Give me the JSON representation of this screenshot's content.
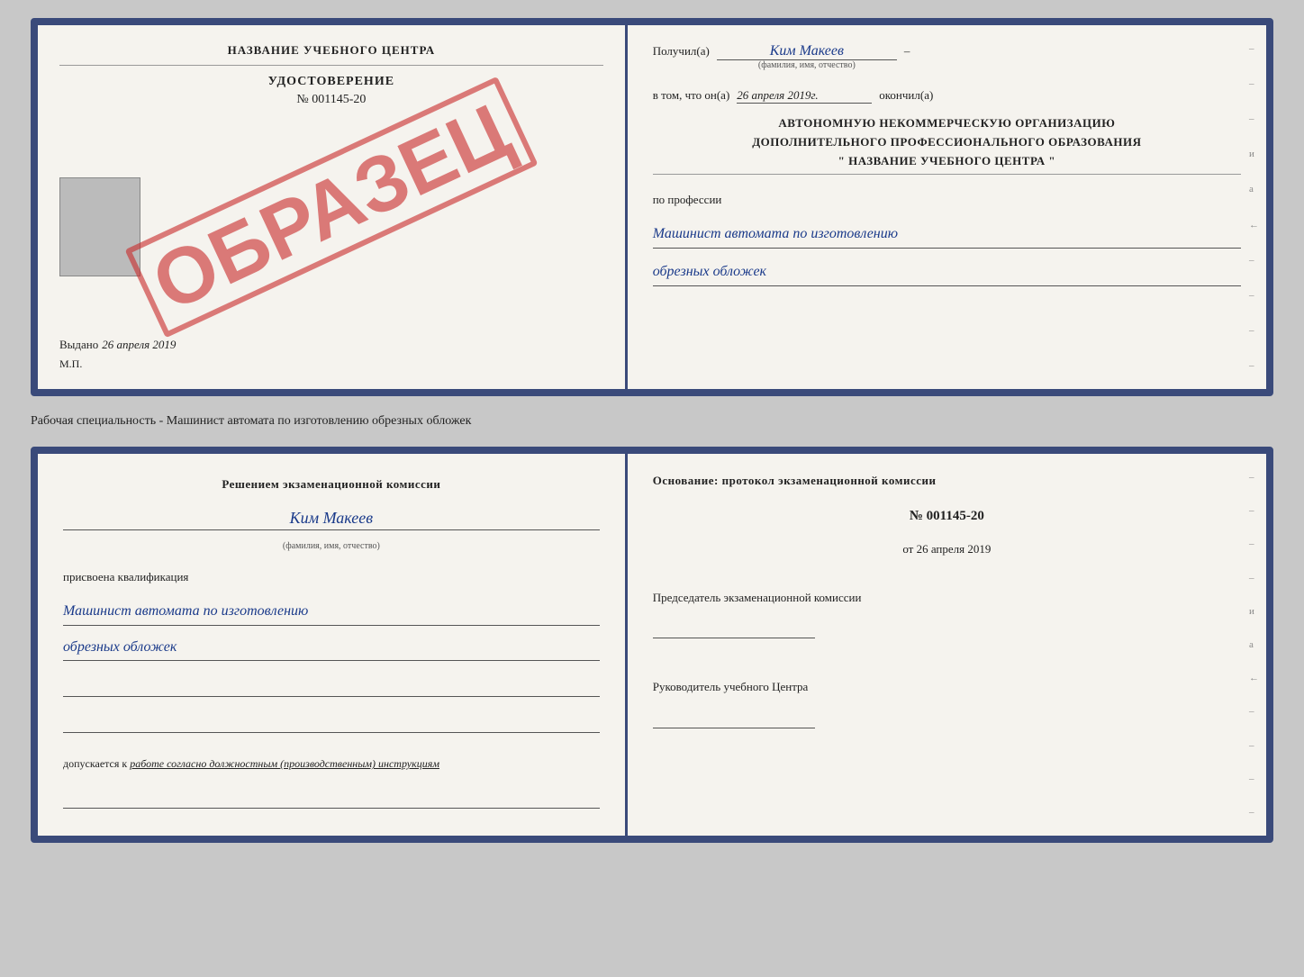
{
  "top_document": {
    "left": {
      "school_name": "НАЗВАНИЕ УЧЕБНОГО ЦЕНТРА",
      "cert_label": "УДОСТОВЕРЕНИЕ",
      "cert_number": "№ 001145-20",
      "stamp_text": "ОБРАЗЕЦ",
      "issued_prefix": "Выдано",
      "issued_date": "26 апреля 2019",
      "mp_label": "М.П."
    },
    "right": {
      "received_prefix": "Получил(а)",
      "received_name": "Ким Макеев",
      "received_subtext": "(фамилия, имя, отчество)",
      "dash": "–",
      "date_prefix": "в том, что он(а)",
      "date_value": "26 апреля 2019г.",
      "finished_suffix": "окончил(а)",
      "org_line1": "АВТОНОМНУЮ НЕКОММЕРЧЕСКУЮ ОРГАНИЗАЦИЮ",
      "org_line2": "ДОПОЛНИТЕЛЬНОГО ПРОФЕССИОНАЛЬНОГО ОБРАЗОВАНИЯ",
      "org_line3": "\"   НАЗВАНИЕ УЧЕБНОГО ЦЕНТРА   \"",
      "profession_label": "по профессии",
      "profession_line1": "Машинист автомата по изготовлению",
      "profession_line2": "обрезных обложек"
    }
  },
  "separator": {
    "text": "Рабочая специальность - Машинист автомата по изготовлению обрезных обложек"
  },
  "bottom_document": {
    "left": {
      "decision_text": "Решением экзаменационной комиссии",
      "person_name": "Ким Макеев",
      "fio_sub": "(фамилия, имя, отчество)",
      "qualification_label": "присвоена квалификация",
      "qualification_line1": "Машинист автомата по изготовлению",
      "qualification_line2": "обрезных обложек",
      "admission_prefix": "допускается к",
      "admission_italic": "работе согласно должностным (производственным) инструкциям"
    },
    "right": {
      "basis_text": "Основание: протокол экзаменационной комиссии",
      "protocol_number": "№  001145-20",
      "date_prefix": "от",
      "date_value": "26 апреля 2019",
      "chairman_title": "Председатель экзаменационной комиссии",
      "director_title": "Руководитель учебного Центра"
    }
  }
}
